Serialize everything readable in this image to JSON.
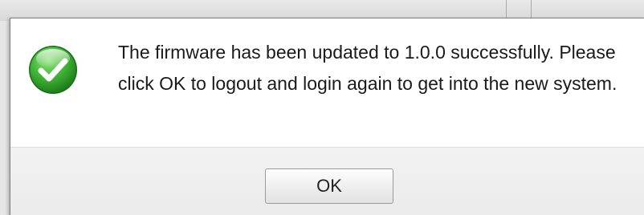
{
  "dialog": {
    "icon": "check-icon",
    "message": "The firmware has been updated to 1.0.0 successfully. Please click OK to logout and login again to get into the new system.",
    "ok_label": "OK"
  },
  "colors": {
    "icon_green": "#3fb536",
    "footer_bg": "#efefef"
  }
}
